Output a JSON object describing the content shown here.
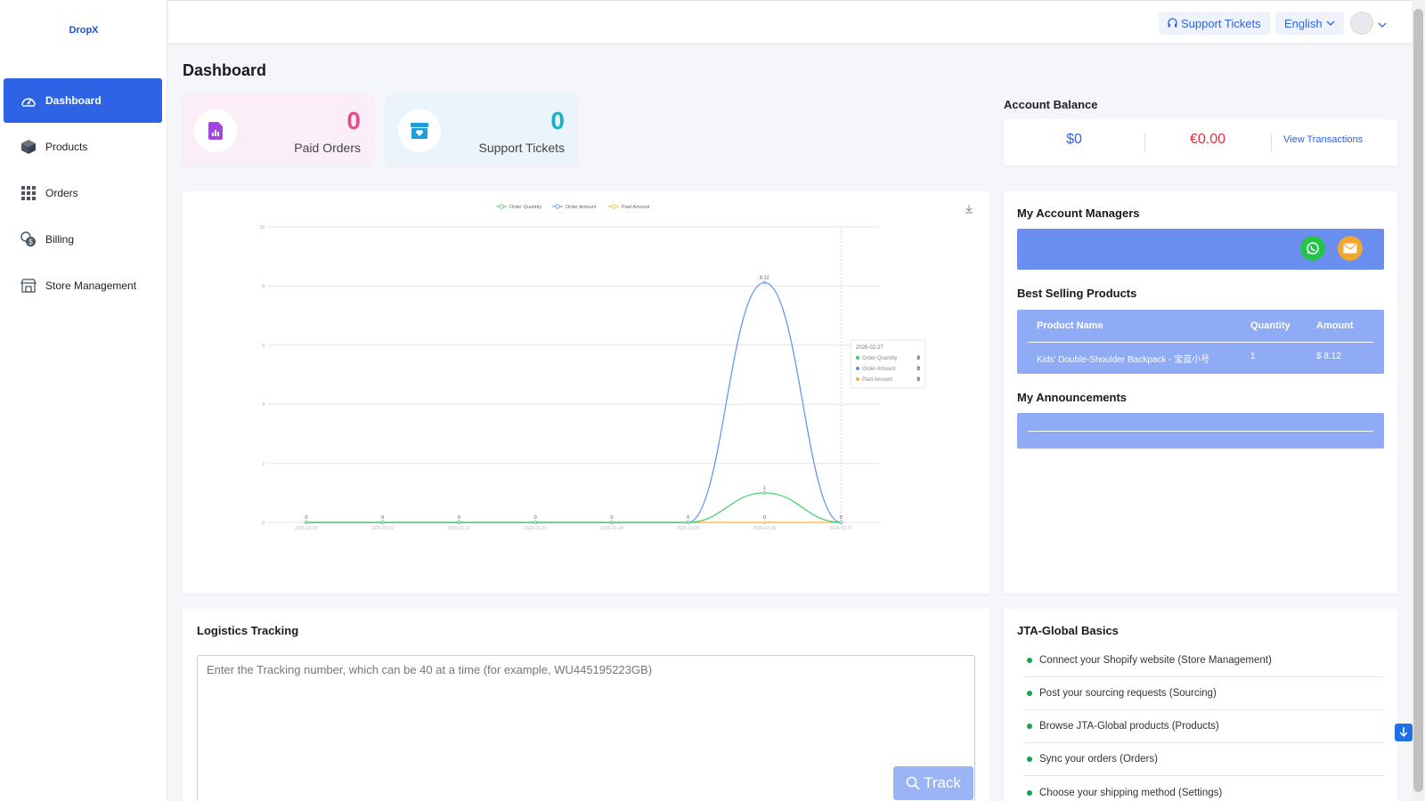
{
  "brand": {
    "name": "DropX"
  },
  "sidebar": {
    "items": [
      {
        "label": "Dashboard",
        "icon": "dashboard-icon",
        "active": true
      },
      {
        "label": "Products",
        "icon": "box-icon"
      },
      {
        "label": "Orders",
        "icon": "grid-icon"
      },
      {
        "label": "Billing",
        "icon": "coins-icon"
      },
      {
        "label": "Store Management",
        "icon": "store-icon"
      }
    ]
  },
  "topbar": {
    "support_label": "Support Tickets",
    "language": "English"
  },
  "page": {
    "title": "Dashboard"
  },
  "stats": {
    "paid_orders": {
      "value": "0",
      "label": "Paid Orders"
    },
    "support_tickets": {
      "value": "0",
      "label": "Support Tickets"
    }
  },
  "balance": {
    "title": "Account Balance",
    "usd": "$0",
    "eur": "€0.00",
    "link": "View Transactions"
  },
  "chart_data": {
    "type": "line",
    "legend": [
      "Order Quantity",
      "Order Amount",
      "Paid Amount"
    ],
    "legend_position": "top-center",
    "x": [
      "2026-02-20",
      "2026-02-21",
      "2026-02-22",
      "2026-02-23",
      "2026-02-24",
      "2026-02-25",
      "2026-02-26",
      "2026-02-27"
    ],
    "series": [
      {
        "name": "Order Quantity",
        "color": "#3ccf6a",
        "values": [
          0,
          0,
          0,
          0,
          0,
          0,
          1,
          0
        ]
      },
      {
        "name": "Order Amount",
        "color": "#5b8ff0",
        "values": [
          0,
          0,
          0,
          0,
          0,
          0,
          8.12,
          0
        ]
      },
      {
        "name": "Paid Amount",
        "color": "#f5b335",
        "values": [
          0,
          0,
          0,
          0,
          0,
          0,
          0,
          0
        ]
      }
    ],
    "ylim": [
      0,
      10
    ],
    "yticks": [
      "0",
      "2",
      "4",
      "6",
      "8",
      "10"
    ],
    "grid": true,
    "data_labels": [
      "0",
      "0",
      "0",
      "0",
      "0",
      "0",
      "0",
      "0",
      "1",
      "8.12"
    ],
    "tooltip": {
      "date": "2026-02-27",
      "rows": [
        {
          "name": "Order Quantity",
          "value": "0",
          "color": "#3ccf6a"
        },
        {
          "name": "Order Amount",
          "value": "0",
          "color": "#5b8ff0"
        },
        {
          "name": "Paid Amount",
          "value": "0",
          "color": "#f5b335"
        }
      ]
    }
  },
  "managers": {
    "title": "My Account Managers"
  },
  "best_selling": {
    "title": "Best Selling Products",
    "headers": [
      "Product Name",
      "Quantity",
      "Amount"
    ],
    "rows": [
      {
        "name": "Kids' Double-Shoulder Backpack - 宝蓝小号",
        "quantity": "1",
        "amount": "$ 8.12"
      }
    ]
  },
  "announcements": {
    "title": "My Announcements"
  },
  "logistics": {
    "title": "Logistics Tracking",
    "placeholder": "Enter the Tracking number, which can be 40 at a time (for example, WU445195223GB)",
    "button": "Track"
  },
  "basics": {
    "title": "JTA-Global Basics",
    "items": [
      "Connect your Shopify website (Store Management)",
      "Post your sourcing requests (Sourcing)",
      "Browse JTA-Global products (Products)",
      "Sync your orders (Orders)",
      "Choose your shipping method (Settings)"
    ]
  },
  "colors": {
    "primary": "#2e63e6",
    "pink_card": "#fbeef8",
    "blue_card": "#eaf4fa"
  }
}
